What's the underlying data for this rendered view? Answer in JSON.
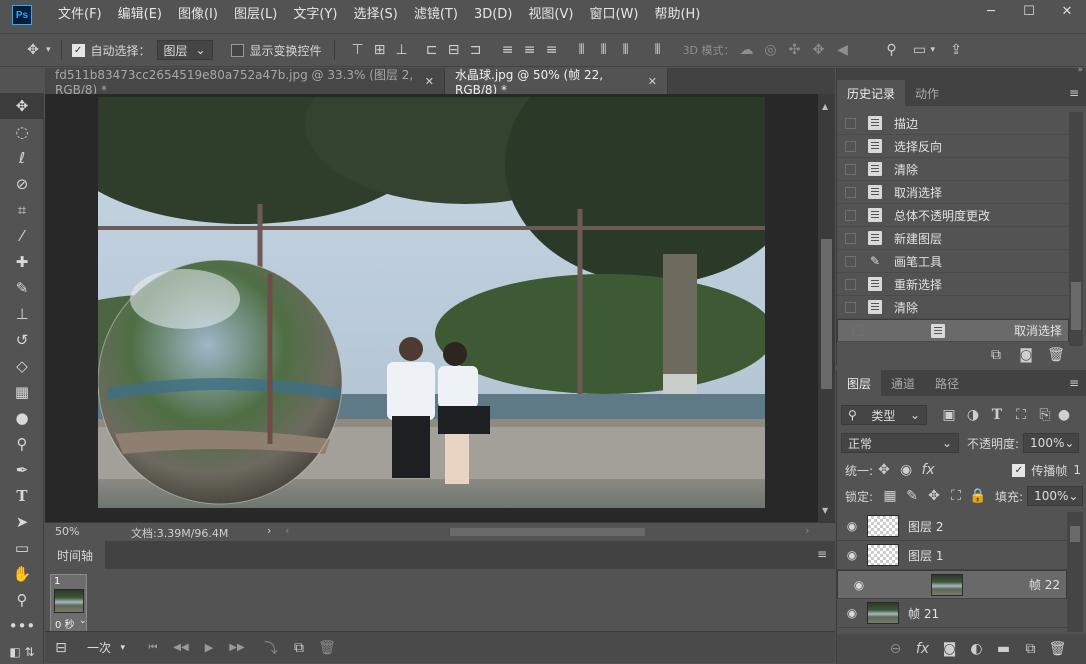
{
  "app": {
    "logo": "Ps"
  },
  "menu": [
    "文件(F)",
    "编辑(E)",
    "图像(I)",
    "图层(L)",
    "文字(Y)",
    "选择(S)",
    "滤镜(T)",
    "3D(D)",
    "视图(V)",
    "窗口(W)",
    "帮助(H)"
  ],
  "options": {
    "auto_select_label": "自动选择：",
    "auto_select_value": "图层",
    "show_transform_label": "显示变换控件",
    "mode3d_label": "3D 模式："
  },
  "tabs": [
    {
      "label": "fd511b83473cc2654519e80a752a47b.jpg @ 33.3% (图层 2, RGB/8) *",
      "active": false
    },
    {
      "label": "水晶球.jpg @ 50% (帧 22, RGB/8) *",
      "active": true
    }
  ],
  "status": {
    "zoom": "50%",
    "doc": "文档:3.39M/96.4M"
  },
  "timeline": {
    "title": "时间轴",
    "frame_number": "1",
    "frame_delay": "0 秒",
    "loop": "一次"
  },
  "history": {
    "tabs": [
      "历史记录",
      "动作"
    ],
    "items": [
      {
        "label": "描边",
        "icon": "history-icon"
      },
      {
        "label": "选择反向",
        "icon": "history-icon"
      },
      {
        "label": "清除",
        "icon": "history-icon"
      },
      {
        "label": "取消选择",
        "icon": "history-icon"
      },
      {
        "label": "总体不透明度更改",
        "icon": "history-icon"
      },
      {
        "label": "新建图层",
        "icon": "history-icon"
      },
      {
        "label": "画笔工具",
        "icon": "brush-icon"
      },
      {
        "label": "重新选择",
        "icon": "history-icon"
      },
      {
        "label": "清除",
        "icon": "history-icon"
      },
      {
        "label": "取消选择",
        "icon": "history-icon"
      }
    ]
  },
  "layers": {
    "tabs": [
      "图层",
      "通道",
      "路径"
    ],
    "filter": "类型",
    "blend_mode": "正常",
    "opacity_label": "不透明度:",
    "opacity": "100%",
    "unify_label": "统一:",
    "propagate_label": "传播帧",
    "propagate_value": "1",
    "lock_label": "锁定:",
    "fill_label": "填充:",
    "fill": "100%",
    "items": [
      {
        "name": "图层 2",
        "type": "transparent"
      },
      {
        "name": "图层 1",
        "type": "transparent"
      },
      {
        "name": "帧 22",
        "type": "photo"
      },
      {
        "name": "帧 21",
        "type": "photo"
      }
    ]
  }
}
